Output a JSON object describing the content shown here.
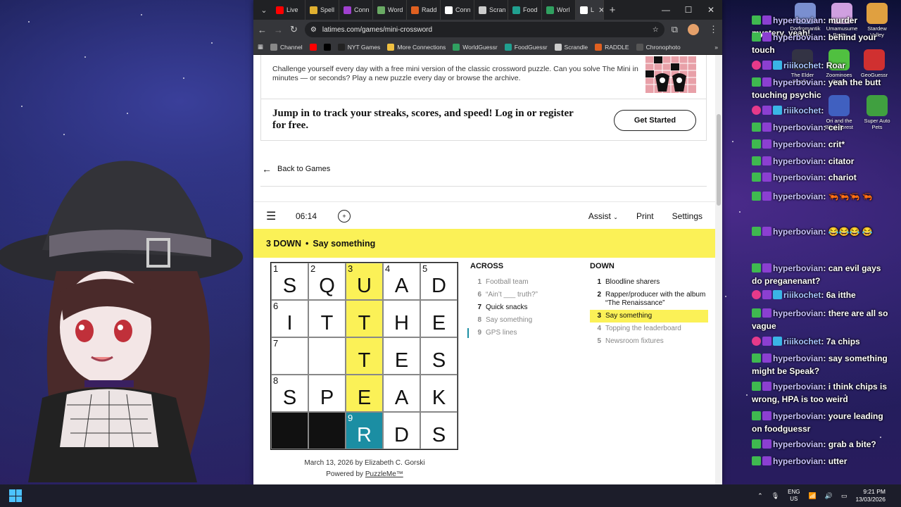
{
  "browser": {
    "tabs": [
      {
        "label": "Live",
        "color": "#ff0000"
      },
      {
        "label": "Spell",
        "color": "#e0b030"
      },
      {
        "label": "Conn",
        "color": "#a040d0"
      },
      {
        "label": "Word",
        "color": "#6aaa64"
      },
      {
        "label": "Radd",
        "color": "#e06020"
      },
      {
        "label": "Conn",
        "color": "#ffffff"
      },
      {
        "label": "Scran",
        "color": "#cccccc"
      },
      {
        "label": "Food",
        "color": "#20a090"
      },
      {
        "label": "Worl",
        "color": "#30a060"
      },
      {
        "label": "L",
        "color": "#ffffff"
      }
    ],
    "url": "latimes.com/games/mini-crossword",
    "bookmarks": [
      {
        "label": "Channel",
        "color": "#888888"
      },
      {
        "label": "",
        "color": "#ff0000"
      },
      {
        "label": "",
        "color": "#000000"
      },
      {
        "label": "NYT Games",
        "color": "#222222"
      },
      {
        "label": "More Connections",
        "color": "#f0c040"
      },
      {
        "label": "WorldGuessr",
        "color": "#30a060"
      },
      {
        "label": "FoodGuessr",
        "color": "#20a090"
      },
      {
        "label": "Scrandle",
        "color": "#cccccc"
      },
      {
        "label": "RADDLE",
        "color": "#e06020"
      },
      {
        "label": "Chronophoto",
        "color": "#555555"
      }
    ]
  },
  "page": {
    "intro_text": "Challenge yourself every day with a free mini version of the classic crossword puzzle. Can you solve The Mini in minutes — or seconds? Play a new puzzle every day or browse the archive.",
    "login_prompt": "Jump in to track your streaks, scores, and speed! Log in or register for free.",
    "get_started": "Get Started",
    "back_to_games": "Back to Games",
    "timer": "06:14",
    "assist": "Assist",
    "print": "Print",
    "settings": "Settings",
    "active_clue_number": "3 DOWN",
    "active_clue_text": "Say something",
    "byline": "March 13, 2026 by Elizabeth C. Gorski",
    "powered_prefix": "Powered by",
    "powered_link": "PuzzleMe™"
  },
  "grid": [
    [
      {
        "n": "1",
        "l": "S"
      },
      {
        "n": "2",
        "l": "Q"
      },
      {
        "n": "3",
        "l": "U",
        "s": "hl"
      },
      {
        "n": "4",
        "l": "A"
      },
      {
        "n": "5",
        "l": "D"
      }
    ],
    [
      {
        "n": "6",
        "l": "I"
      },
      {
        "n": "",
        "l": "T"
      },
      {
        "n": "",
        "l": "T",
        "s": "hl"
      },
      {
        "n": "",
        "l": "H"
      },
      {
        "n": "",
        "l": "E"
      }
    ],
    [
      {
        "n": "7",
        "l": ""
      },
      {
        "n": "",
        "l": ""
      },
      {
        "n": "",
        "l": "T",
        "s": "hl"
      },
      {
        "n": "",
        "l": "E"
      },
      {
        "n": "",
        "l": "S"
      }
    ],
    [
      {
        "n": "8",
        "l": "S"
      },
      {
        "n": "",
        "l": "P"
      },
      {
        "n": "",
        "l": "E",
        "s": "hl"
      },
      {
        "n": "",
        "l": "A"
      },
      {
        "n": "",
        "l": "K"
      }
    ],
    [
      {
        "n": "",
        "l": "",
        "s": "black"
      },
      {
        "n": "",
        "l": "",
        "s": "black"
      },
      {
        "n": "9",
        "l": "R",
        "s": "active"
      },
      {
        "n": "",
        "l": "D"
      },
      {
        "n": "",
        "l": "S"
      }
    ]
  ],
  "across": {
    "title": "ACROSS",
    "clues": [
      {
        "num": "1",
        "text": "Football team",
        "state": "done"
      },
      {
        "num": "6",
        "text": "“Ain’t ___ truth?”",
        "state": "done"
      },
      {
        "num": "7",
        "text": "Quick snacks",
        "state": ""
      },
      {
        "num": "8",
        "text": "Say something",
        "state": "done"
      },
      {
        "num": "9",
        "text": "GPS lines",
        "state": "done marker"
      }
    ]
  },
  "down": {
    "title": "DOWN",
    "clues": [
      {
        "num": "1",
        "text": "Bloodline sharers",
        "state": ""
      },
      {
        "num": "2",
        "text": "Rapper/producer with the album “The Renaissance”",
        "state": ""
      },
      {
        "num": "3",
        "text": "Say something",
        "state": "sel"
      },
      {
        "num": "4",
        "text": "Topping the leaderboard",
        "state": "done"
      },
      {
        "num": "5",
        "text": "Newsroom fixtures",
        "state": "done"
      }
    ]
  },
  "desktop_icons": [
    {
      "label": "Dorfromantik",
      "color": "#7a8fd0"
    },
    {
      "label": "Umamusume Pretty...",
      "color": "#d0a0e0"
    },
    {
      "label": "Stardew Valley",
      "color": "#e0a040"
    },
    {
      "label": "The Elder Scrolls...",
      "color": "#333344"
    },
    {
      "label": "Zoominoes Demo",
      "color": "#50c040"
    },
    {
      "label": "GeoGuessr",
      "color": "#d03030"
    },
    {
      "label": "Ori and the Blind Forest",
      "color": "#4060c0"
    },
    {
      "label": "Super Auto Pets",
      "color": "#40a040"
    }
  ],
  "chat": [
    {
      "user": "hyperbovian",
      "text": "murder mystery, yeah!",
      "badges": [
        "check",
        "star"
      ]
    },
    {
      "user": "hyperbovian",
      "text": "behind your touch",
      "badges": [
        "check",
        "star"
      ]
    },
    {
      "user": "riiikochet",
      "text": "Roar",
      "badges": [
        "heart",
        "star",
        "sub"
      ]
    },
    {
      "user": "hyperbovian",
      "text": "yeah the butt touching psychic",
      "badges": [
        "check",
        "star"
      ]
    },
    {
      "user": "riiikochet",
      "text": "",
      "badges": [
        "heart",
        "star",
        "sub"
      ]
    },
    {
      "user": "hyperbovian",
      "text": "ceir",
      "badges": [
        "check",
        "star"
      ]
    },
    {
      "user": "hyperbovian",
      "text": "crit*",
      "badges": [
        "check",
        "star"
      ]
    },
    {
      "user": "hyperbovian",
      "text": "citator",
      "badges": [
        "check",
        "star"
      ]
    },
    {
      "user": "hyperbovian",
      "text": "chariot",
      "badges": [
        "check",
        "star"
      ]
    },
    {
      "user": "hyperbovian",
      "text": "🦐🦐🦐 🦐",
      "badges": [
        "check",
        "star"
      ]
    },
    {
      "user": "hyperbovian",
      "text": "😂😂😂 😂",
      "badges": [
        "check",
        "star"
      ]
    },
    {
      "user": "hyperbovian",
      "text": "can evil gays do preganenant?",
      "badges": [
        "check",
        "star"
      ]
    },
    {
      "user": "riiikochet",
      "text": "6a itthe",
      "badges": [
        "heart",
        "star",
        "sub"
      ]
    },
    {
      "user": "hyperbovian",
      "text": "there are all so vague",
      "badges": [
        "check",
        "star"
      ]
    },
    {
      "user": "riiikochet",
      "text": "7a chips",
      "badges": [
        "heart",
        "star",
        "sub"
      ]
    },
    {
      "user": "hyperbovian",
      "text": "say something might be Speak?",
      "badges": [
        "check",
        "star"
      ]
    },
    {
      "user": "hyperbovian",
      "text": "i think chips is wrong, HPA is too weird",
      "badges": [
        "check",
        "star"
      ]
    },
    {
      "user": "hyperbovian",
      "text": "youre leading on foodguessr",
      "badges": [
        "check",
        "star"
      ]
    },
    {
      "user": "hyperbovian",
      "text": "grab a bite?",
      "badges": [
        "check",
        "star"
      ]
    },
    {
      "user": "hyperbovian",
      "text": "utter",
      "badges": [
        "check",
        "star"
      ]
    }
  ],
  "taskbar": {
    "lang_top": "ENG",
    "lang_bottom": "US",
    "time": "9:21 PM",
    "date": "13/03/2026"
  }
}
